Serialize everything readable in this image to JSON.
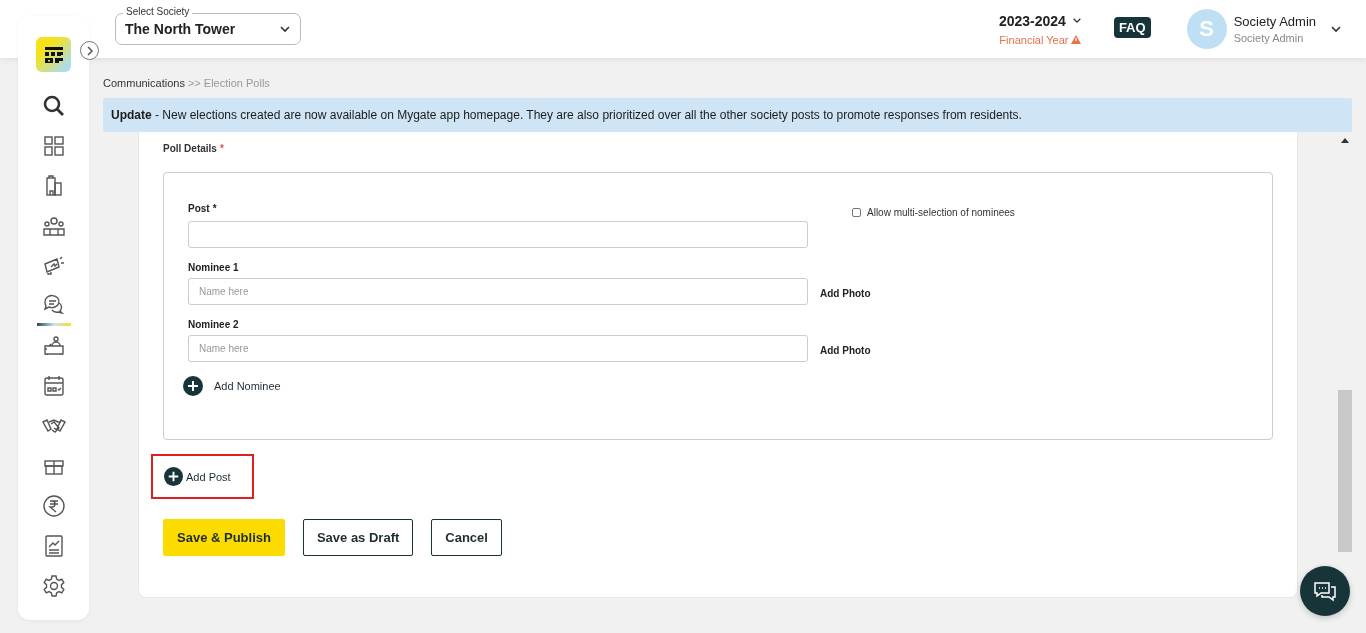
{
  "header": {
    "society_label": "Select Society",
    "society": "The North Tower",
    "year": "2023-2024",
    "year_caption": "Financial Year",
    "faq": "FAQ",
    "avatar_initial": "S",
    "user_name": "Society Admin",
    "user_role": "Society Admin"
  },
  "sidebar": {
    "items": [
      {
        "selected": false
      },
      {
        "selected": false
      },
      {
        "selected": false
      },
      {
        "selected": false
      },
      {
        "selected": false
      },
      {
        "selected": true
      },
      {
        "selected": false
      },
      {
        "selected": false
      },
      {
        "selected": false
      },
      {
        "selected": false
      },
      {
        "selected": false
      },
      {
        "selected": false
      },
      {
        "selected": false
      }
    ]
  },
  "breadcrumb": [
    {
      "label": "Communications",
      "current": false
    },
    {
      "label": ">> Election Polls",
      "current": true
    }
  ],
  "banner": {
    "text": "**Update** - New elections created are now available on Mygate app homepage. They are also prioritized over all the other society posts to promote responses from residents."
  },
  "form": {
    "section_label": "Poll Details",
    "section_required_mark": "*",
    "post": {
      "label": "Post",
      "required_mark": "*"
    },
    "multi_select": {
      "label": "Allow multi-selection of nominees",
      "checked": false
    },
    "nominees": [
      {
        "label": "Nominee 1",
        "placeholder": "Name here",
        "photo_action": "Add Photo"
      },
      {
        "label": "Nominee 2",
        "placeholder": "Name here",
        "photo_action": "Add Photo"
      }
    ],
    "add_nominee": "Add Nominee",
    "add_post": {
      "label": "Add Post",
      "highlighted": true
    },
    "buttons": [
      {
        "label": "Save & Publish",
        "kind": "primary"
      },
      {
        "label": "Save as Draft",
        "kind": "outline"
      },
      {
        "label": "Cancel",
        "kind": "outline"
      }
    ]
  }
}
